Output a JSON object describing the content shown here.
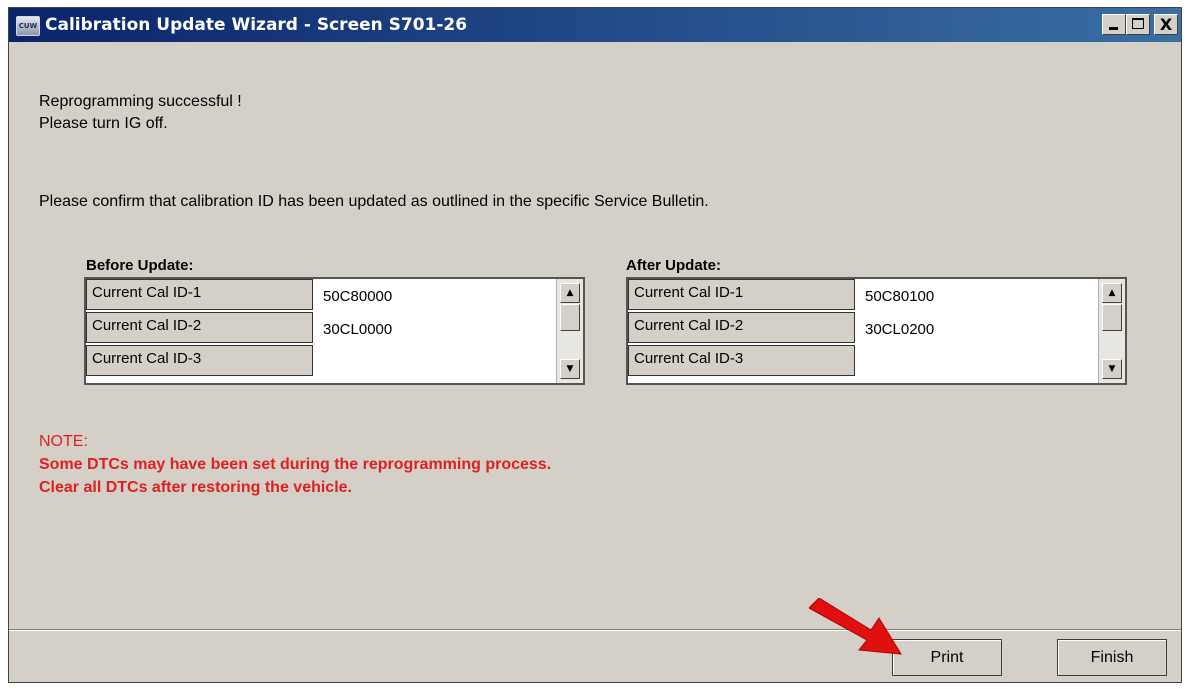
{
  "window": {
    "app_icon": "CUW",
    "title": "Calibration Update Wizard - Screen S701-26",
    "controls": {
      "minimize": "minimize-icon",
      "maximize": "maximize-icon",
      "close": "X"
    }
  },
  "message": {
    "line1": "Reprogramming successful !",
    "line2": "Please turn IG off.",
    "line3": "Please confirm that calibration ID has been updated as outlined in the specific Service Bulletin."
  },
  "before": {
    "heading": "Before Update:",
    "rows": [
      {
        "label": "Current Cal ID-1",
        "value": "50C80000"
      },
      {
        "label": "Current Cal ID-2",
        "value": "30CL0000"
      },
      {
        "label": "Current Cal ID-3",
        "value": ""
      }
    ]
  },
  "after": {
    "heading": "After Update:",
    "rows": [
      {
        "label": "Current Cal ID-1",
        "value": "50C80100"
      },
      {
        "label": "Current Cal ID-2",
        "value": "30CL0200"
      },
      {
        "label": "Current Cal ID-3",
        "value": ""
      }
    ]
  },
  "note": {
    "title": "NOTE:",
    "line1": "Some DTCs may have been set during the reprogramming process.",
    "line2": "Clear all DTCs after restoring the vehicle."
  },
  "buttons": {
    "print": "Print",
    "finish": "Finish"
  },
  "colors": {
    "title_bar": "#0a246a",
    "note_text": "#e02020",
    "arrow": "#e01010",
    "face": "#d4d0c8"
  }
}
